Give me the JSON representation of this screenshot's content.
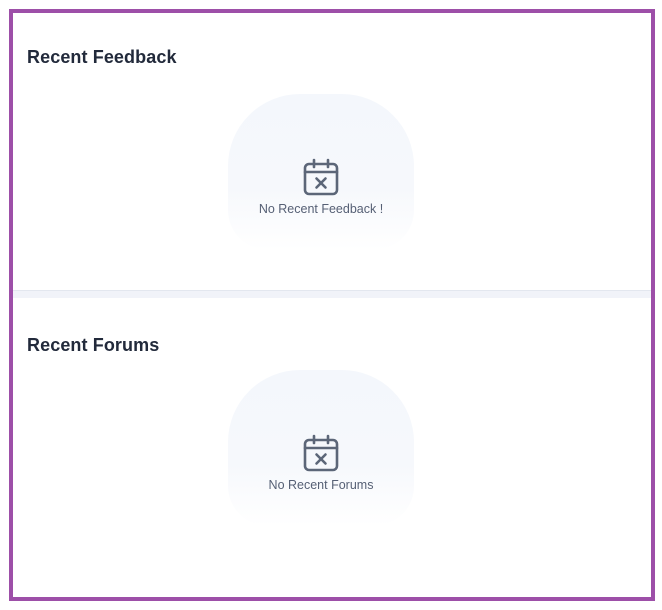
{
  "recent_feedback": {
    "title": "Recent Feedback",
    "empty_icon": "calendar-x-icon",
    "empty_text": "No Recent Feedback !"
  },
  "recent_forums": {
    "title": "Recent Forums",
    "empty_icon": "calendar-x-icon",
    "empty_text": "No Recent Forums"
  },
  "colors": {
    "frame_border": "#9d4fa8",
    "heading_text": "#222a3b",
    "muted_text": "#566075",
    "icon_stroke": "#5c6678",
    "empty_bg": "#f4f7fc"
  }
}
